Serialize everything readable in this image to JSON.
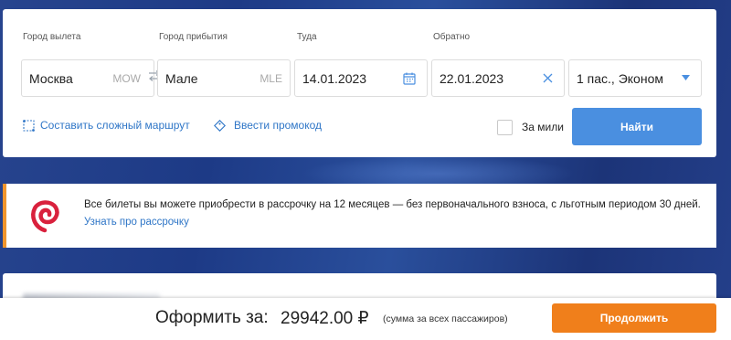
{
  "search": {
    "origin": {
      "label": "Город вылета",
      "value": "Москва",
      "code": "MOW"
    },
    "destination": {
      "label": "Город прибытия",
      "value": "Мале",
      "code": "MLE"
    },
    "depart": {
      "label": "Туда",
      "value": "14.01.2023"
    },
    "return": {
      "label": "Обратно",
      "value": "22.01.2023"
    },
    "passengers": {
      "value": "1 пас., Эконом"
    },
    "complex_route_link": "Составить сложный маршрут",
    "promo_code_link": "Ввести промокод",
    "miles_label": "За мили",
    "find_button": "Найти"
  },
  "installment": {
    "text": "Все билеты вы можете приобрести в рассрочку на 12 месяцев — без первоначального взноса, с льготным периодом 30 дней.",
    "link": "Узнать про рассрочку"
  },
  "checkout": {
    "label": "Оформить за:",
    "amount": "29942.00 ₽",
    "note": "(сумма за всех пассажиров)",
    "continue_button": "Продолжить"
  },
  "colors": {
    "accent_blue": "#4a8fe0",
    "link_blue": "#2f76c7",
    "accent_orange": "#f07f1b",
    "promo_logo": "#d9213d"
  },
  "icons": [
    "swap-icon",
    "calendar-icon",
    "clear-icon",
    "caret-down-icon",
    "route-icon",
    "promo-icon",
    "installment-logo-icon"
  ]
}
